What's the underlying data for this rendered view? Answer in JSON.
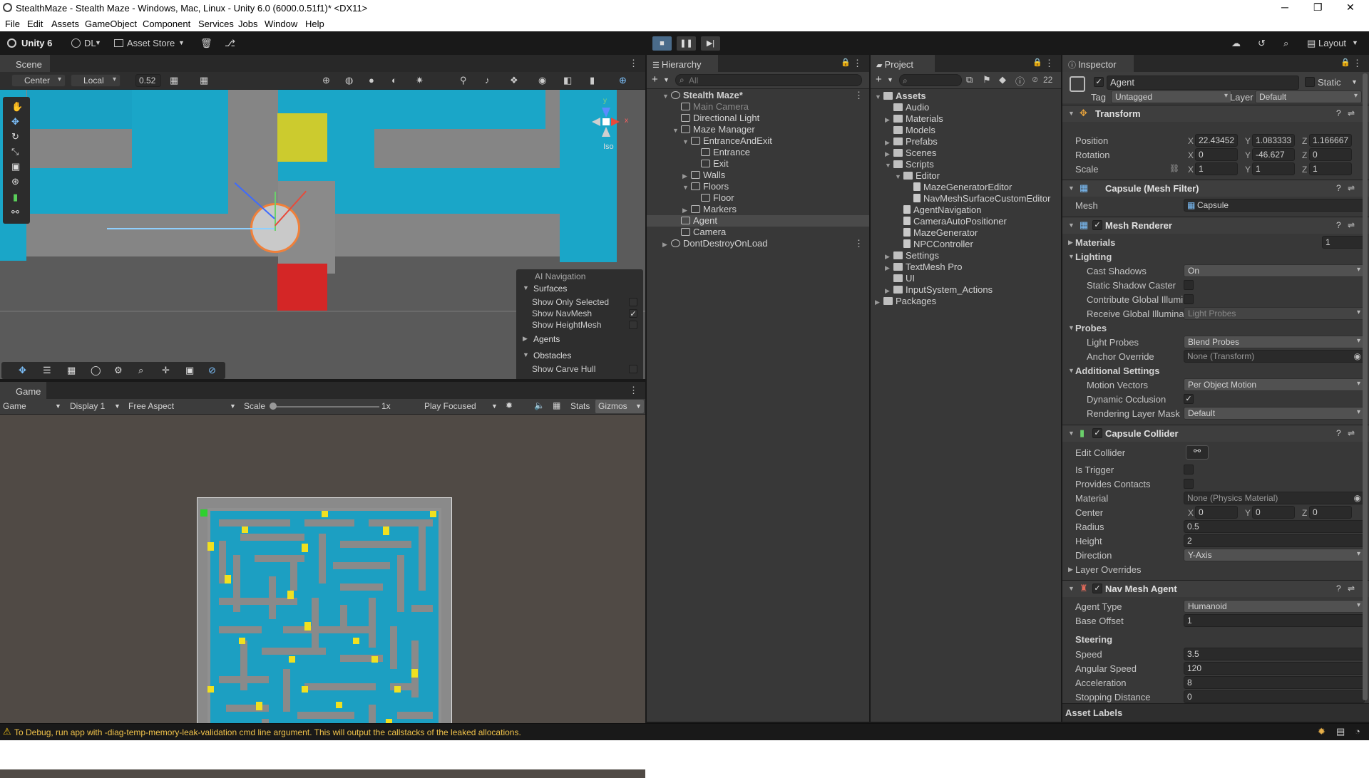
{
  "titlebar": {
    "title": "StealthMaze - Stealth Maze - Windows, Mac, Linux - Unity 6.0 (6000.0.51f1)* <DX11>",
    "min": "─",
    "max": "❐",
    "close": "✕"
  },
  "menu": [
    "File",
    "Edit",
    "Assets",
    "GameObject",
    "Component",
    "Services",
    "Jobs",
    "Window",
    "Help"
  ],
  "toolbar": {
    "unity": "Unity 6",
    "account": "DL",
    "store": "Asset Store",
    "layout": "Layout"
  },
  "scene": {
    "tab": "Scene",
    "pivot": "Center",
    "space": "Local",
    "snap": "0.52",
    "iso": "Iso",
    "gizmo_y": "y",
    "gizmo_x": "x",
    "gizmo_z": "z",
    "overlay": {
      "title": "AI Navigation",
      "surfaces": "Surfaces",
      "opt1": "Show Only Selected",
      "opt2": "Show NavMesh",
      "opt3": "Show HeightMesh",
      "agents": "Agents",
      "obstacles": "Obstacles",
      "opt4": "Show Carve Hull"
    }
  },
  "game": {
    "tab": "Game",
    "mode": "Game",
    "display": "Display 1",
    "aspect": "Free Aspect",
    "scale_label": "Scale",
    "scale_val": "1x",
    "play": "Play Focused",
    "stats": "Stats",
    "gizmos": "Gizmos"
  },
  "hierarchy": {
    "tab": "Hierarchy",
    "search": "All",
    "items": [
      {
        "label": "Stealth Maze*",
        "indent": 0
      },
      {
        "label": "Main Camera",
        "indent": 1
      },
      {
        "label": "Directional Light",
        "indent": 1
      },
      {
        "label": "Maze Manager",
        "indent": 1
      },
      {
        "label": "EntranceAndExit",
        "indent": 2
      },
      {
        "label": "Entrance",
        "indent": 3
      },
      {
        "label": "Exit",
        "indent": 3
      },
      {
        "label": "Walls",
        "indent": 2
      },
      {
        "label": "Floors",
        "indent": 2
      },
      {
        "label": "Floor",
        "indent": 3
      },
      {
        "label": "Markers",
        "indent": 2
      },
      {
        "label": "Agent",
        "indent": 1
      },
      {
        "label": "Camera",
        "indent": 1
      },
      {
        "label": "DontDestroyOnLoad",
        "indent": 0
      }
    ]
  },
  "project": {
    "tab": "Project",
    "count": "22",
    "items": [
      {
        "label": "Assets",
        "indent": 0
      },
      {
        "label": "Audio",
        "indent": 1
      },
      {
        "label": "Materials",
        "indent": 1
      },
      {
        "label": "Models",
        "indent": 1
      },
      {
        "label": "Prefabs",
        "indent": 1
      },
      {
        "label": "Scenes",
        "indent": 1
      },
      {
        "label": "Scripts",
        "indent": 1
      },
      {
        "label": "Editor",
        "indent": 2
      },
      {
        "label": "MazeGeneratorEditor",
        "indent": 3
      },
      {
        "label": "NavMeshSurfaceCustomEditor",
        "indent": 3
      },
      {
        "label": "AgentNavigation",
        "indent": 2
      },
      {
        "label": "CameraAutoPositioner",
        "indent": 2
      },
      {
        "label": "MazeGenerator",
        "indent": 2
      },
      {
        "label": "NPCController",
        "indent": 2
      },
      {
        "label": "Settings",
        "indent": 1
      },
      {
        "label": "TextMesh Pro",
        "indent": 1
      },
      {
        "label": "UI",
        "indent": 1
      },
      {
        "label": "InputSystem_Actions",
        "indent": 1
      },
      {
        "label": "Packages",
        "indent": 0
      }
    ]
  },
  "inspector": {
    "tab": "Inspector",
    "object": "Agent",
    "static": "Static",
    "tag_label": "Tag",
    "tag": "Untagged",
    "layer_label": "Layer",
    "layer": "Default",
    "transform": {
      "title": "Transform",
      "pos": "Position",
      "rot": "Rotation",
      "scale": "Scale",
      "px": "22.43452",
      "py": "1.083333",
      "pz": "1.166667",
      "rx": "0",
      "ry": "-46.627",
      "rz": "0",
      "sx": "1",
      "sy": "1",
      "sz": "1"
    },
    "meshfilter": {
      "title": "Capsule (Mesh Filter)",
      "mesh_label": "Mesh",
      "mesh": "Capsule"
    },
    "renderer": {
      "title": "Mesh Renderer",
      "materials": "Materials",
      "materials_count": "1",
      "lighting": "Lighting",
      "cast": "Cast Shadows",
      "cast_val": "On",
      "static_caster": "Static Shadow Caster",
      "contrib": "Contribute Global Illumin",
      "receive": "Receive Global Illuminati",
      "receive_val": "Light Probes",
      "probes": "Probes",
      "lp": "Light Probes",
      "lp_val": "Blend Probes",
      "anchor": "Anchor Override",
      "anchor_val": "None (Transform)",
      "additional": "Additional Settings",
      "motion": "Motion Vectors",
      "motion_val": "Per Object Motion",
      "dynocc": "Dynamic Occlusion",
      "rlm": "Rendering Layer Mask",
      "rlm_val": "Default"
    },
    "collider": {
      "title": "Capsule Collider",
      "edit": "Edit Collider",
      "trigger": "Is Trigger",
      "contacts": "Provides Contacts",
      "material": "Material",
      "material_val": "None (Physics Material)",
      "center": "Center",
      "cx": "0",
      "cy": "0",
      "cz": "0",
      "radius": "Radius",
      "radius_val": "0.5",
      "height": "Height",
      "height_val": "2",
      "direction": "Direction",
      "direction_val": "Y-Axis",
      "overrides": "Layer Overrides"
    },
    "navagent": {
      "title": "Nav Mesh Agent",
      "type": "Agent Type",
      "type_val": "Humanoid",
      "offset": "Base Offset",
      "offset_val": "1",
      "steering": "Steering",
      "speed": "Speed",
      "speed_val": "3.5",
      "angular": "Angular Speed",
      "angular_val": "120",
      "accel": "Acceleration",
      "accel_val": "8",
      "stopping": "Stopping Distance",
      "stopping_val": "0"
    },
    "asset_labels": "Asset Labels"
  },
  "status": "To Debug, run app with -diag-temp-memory-leak-validation cmd line argument. This will output the callstacks of the leaked allocations."
}
